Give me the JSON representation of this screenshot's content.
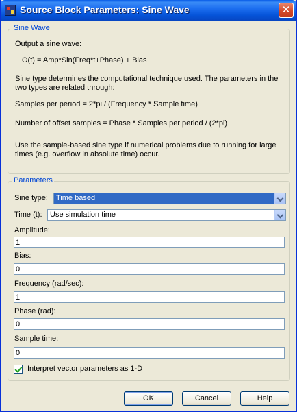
{
  "window": {
    "title": "Source Block Parameters: Sine Wave"
  },
  "description_group": {
    "label": "Sine Wave",
    "lines": [
      "Output a sine wave:",
      "O(t) = Amp*Sin(Freq*t+Phase) + Bias",
      "Sine type determines the computational technique used. The parameters in the two types are related through:",
      "Samples per period = 2*pi / (Frequency * Sample time)",
      "Number of offset samples = Phase * Samples per period / (2*pi)",
      "Use the sample-based sine type if numerical problems due to running for large times (e.g. overflow in absolute time) occur."
    ]
  },
  "parameters": {
    "label": "Parameters",
    "sine_type": {
      "label": "Sine type:",
      "value": "Time based"
    },
    "time": {
      "label": "Time (t):",
      "value": "Use simulation time"
    },
    "amplitude": {
      "label": "Amplitude:",
      "value": "1"
    },
    "bias": {
      "label": "Bias:",
      "value": "0"
    },
    "frequency": {
      "label": "Frequency (rad/sec):",
      "value": "1"
    },
    "phase": {
      "label": "Phase (rad):",
      "value": "0"
    },
    "sample_time": {
      "label": "Sample time:",
      "value": "0"
    },
    "interpret_vector": {
      "label": "Interpret vector parameters as 1-D",
      "checked": true
    }
  },
  "buttons": {
    "ok": "OK",
    "cancel": "Cancel",
    "help": "Help"
  }
}
